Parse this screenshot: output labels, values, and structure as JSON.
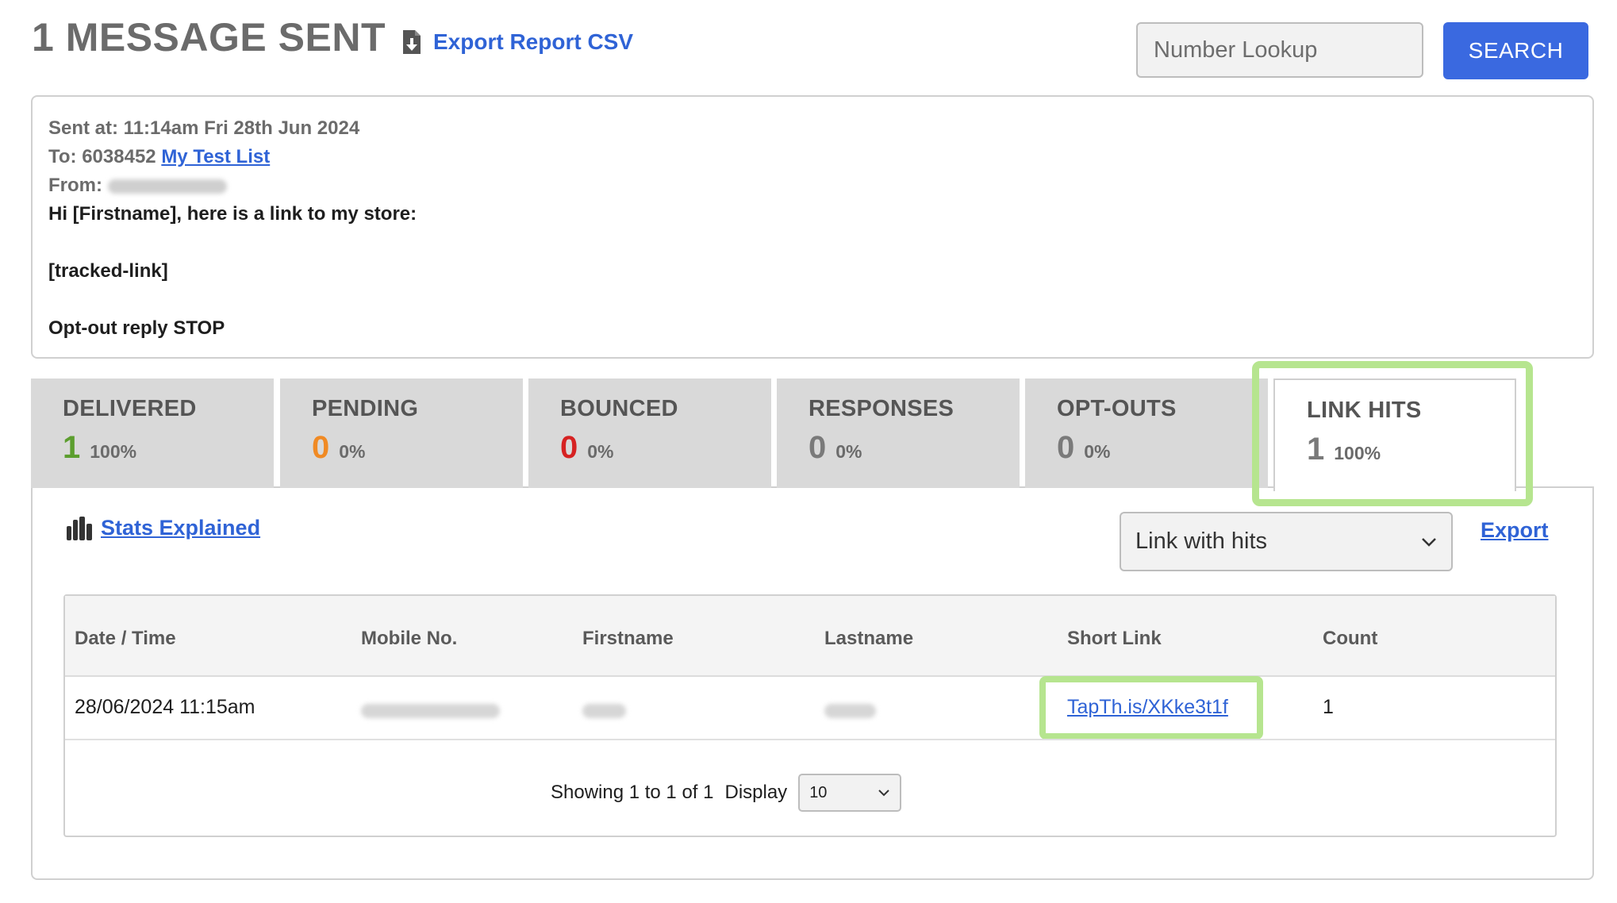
{
  "header": {
    "title": "1 MESSAGE SENT",
    "export_csv_label": "Export Report CSV",
    "lookup_placeholder": "Number Lookup",
    "search_label": "SEARCH"
  },
  "message": {
    "sent_at": "Sent at: 11:14am Fri 28th Jun 2024",
    "to_prefix": "To: 6038452",
    "to_list": "My Test List",
    "from_label": "From:",
    "body_lines": [
      "Hi [Firstname], here is a link to my store:",
      "",
      "[tracked-link]",
      "",
      "Opt-out reply STOP"
    ]
  },
  "tabs": [
    {
      "label": "DELIVERED",
      "value": "1",
      "percent": "100%",
      "color": "#5c9e2e"
    },
    {
      "label": "PENDING",
      "value": "0",
      "percent": "0%",
      "color": "#f08a24"
    },
    {
      "label": "BOUNCED",
      "value": "0",
      "percent": "0%",
      "color": "#d62222"
    },
    {
      "label": "RESPONSES",
      "value": "0",
      "percent": "0%",
      "color": "#7a7a7a"
    },
    {
      "label": "OPT-OUTS",
      "value": "0",
      "percent": "0%",
      "color": "#7a7a7a"
    },
    {
      "label": "LINK HITS",
      "value": "1",
      "percent": "100%",
      "color": "#7a7a7a"
    }
  ],
  "panel": {
    "stats_explained": "Stats Explained",
    "filter_selected": "Link with hits",
    "export_label": "Export"
  },
  "table": {
    "columns": [
      "Date / Time",
      "Mobile No.",
      "Firstname",
      "Lastname",
      "Short Link",
      "Count"
    ],
    "rows": [
      {
        "datetime": "28/06/2024 11:15am",
        "short_link": "TapTh.is/XKke3t1f",
        "count": "1"
      }
    ]
  },
  "pager": {
    "showing": "Showing 1 to 1 of 1",
    "display_label": "Display",
    "page_size": "10"
  }
}
